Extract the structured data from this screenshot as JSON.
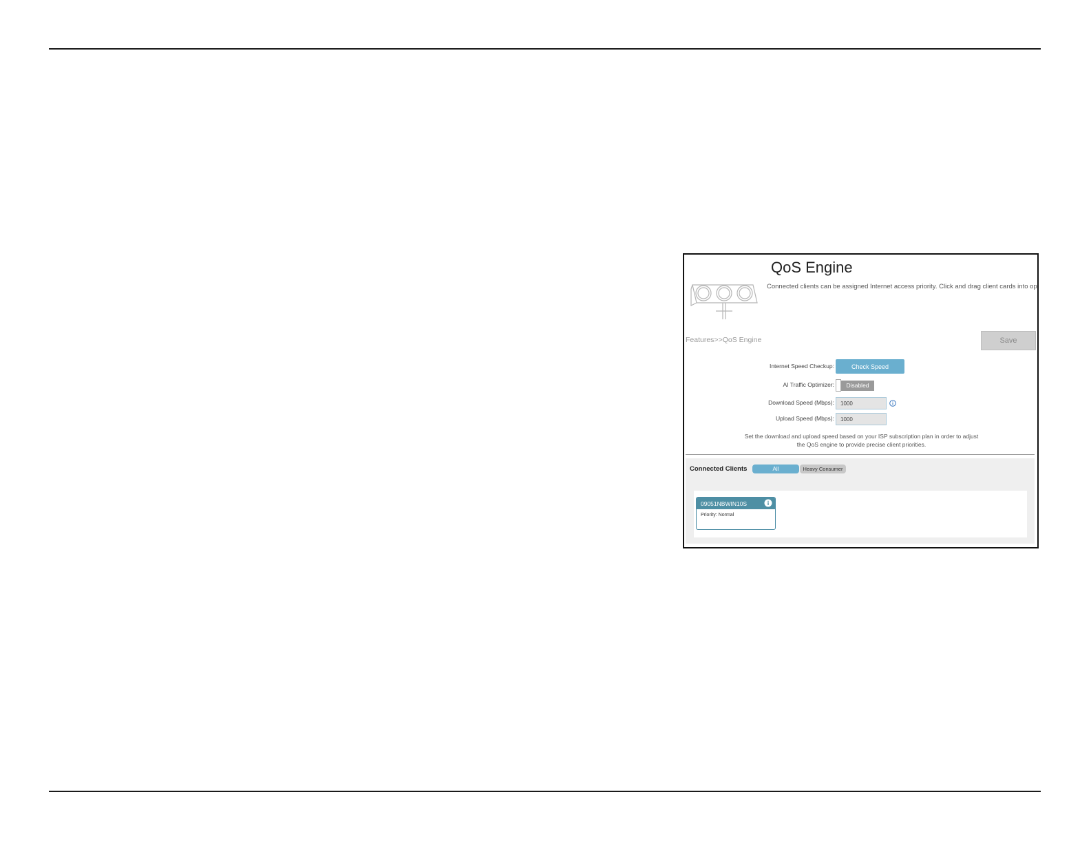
{
  "page": {
    "title": "QoS Engine",
    "description": "Connected clients can be assigned Internet access priority. Click and drag client cards into open slots.",
    "breadcrumb": "Features>>QoS Engine",
    "save_label": "Save"
  },
  "form": {
    "speed_checkup_label": "Internet Speed Checkup:",
    "check_speed_label": "Check Speed",
    "ai_optimizer_label": "AI Traffic Optimizer:",
    "ai_optimizer_state": "Disabled",
    "download_label": "Download Speed (Mbps):",
    "download_value": "1000",
    "upload_label": "Upload Speed (Mbps):",
    "upload_value": "1000",
    "helper_line1": "Set the download and upload speed based on your ISP subscription plan in order to adjust",
    "helper_line2": "the QoS engine to provide precise client priorities."
  },
  "clients": {
    "title": "Connected Clients",
    "filters": [
      "All",
      "Heavy Consumer"
    ],
    "active_filter": "All",
    "cards": [
      {
        "name": "09051NBWIN10S",
        "priority": "Priority: Normal"
      }
    ]
  },
  "colors": {
    "accent": "#6aafcf",
    "card_header": "#4e8fa4",
    "disabled": "#9a9a9a",
    "save_bg": "#cfcfcf"
  },
  "icons": {
    "hero": "traffic-lights-icon",
    "info": "info-icon"
  }
}
